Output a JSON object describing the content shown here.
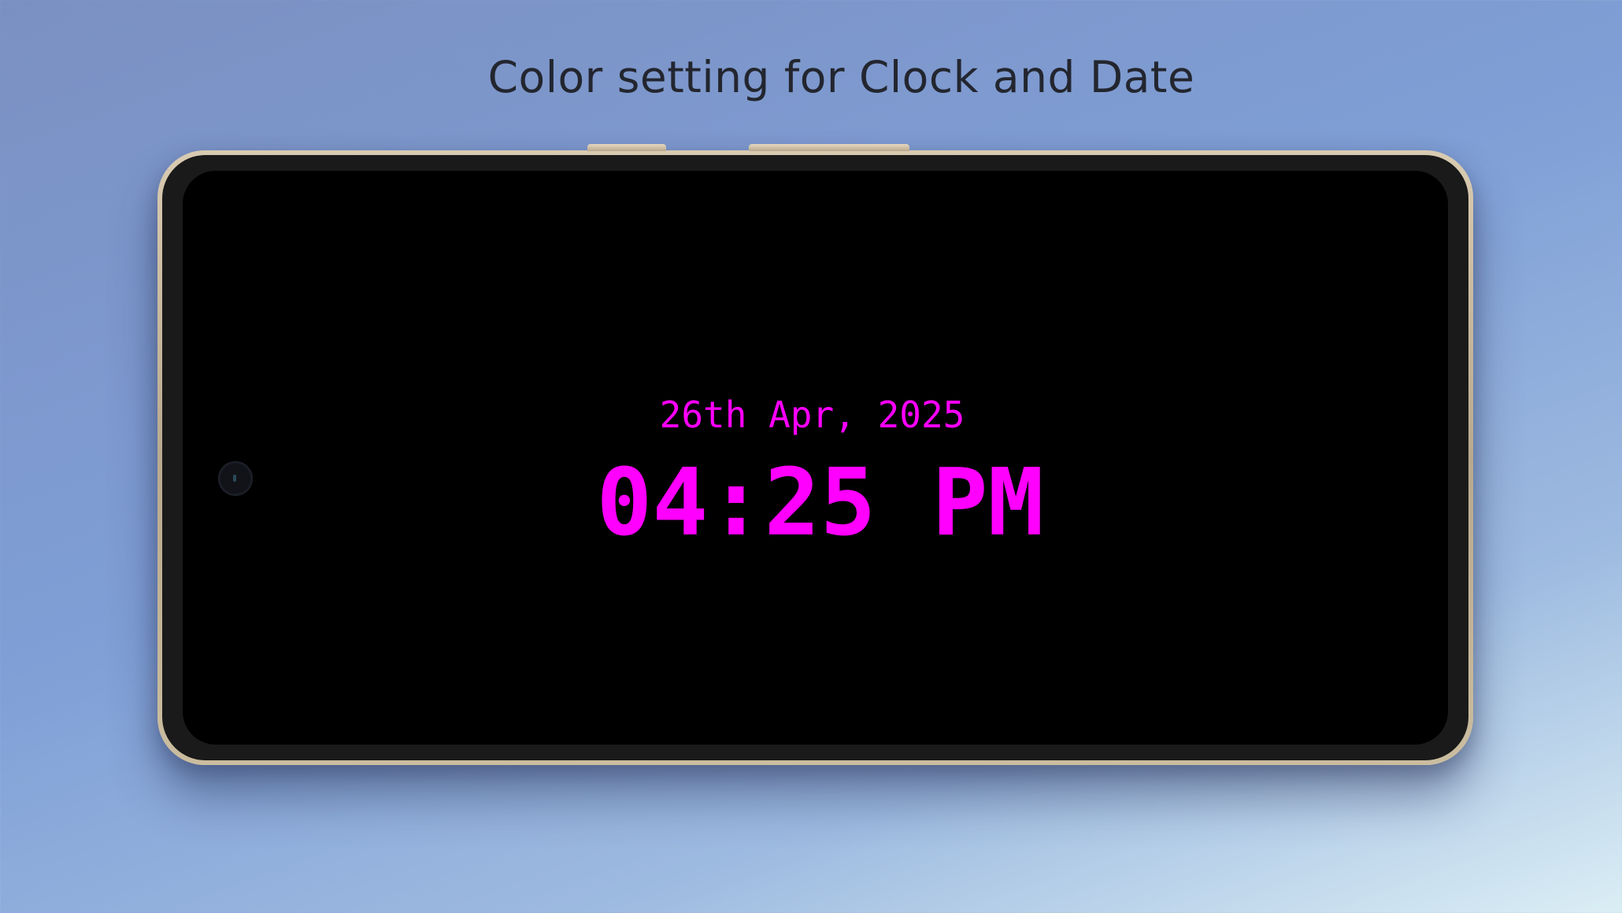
{
  "headline": "Color setting for Clock and Date",
  "clock": {
    "date": "26th Apr, 2025",
    "time": "04:25 PM",
    "color": "#ff00ff"
  },
  "device": {
    "screen_color": "#000000",
    "frame_color": "#cbbd9f"
  }
}
